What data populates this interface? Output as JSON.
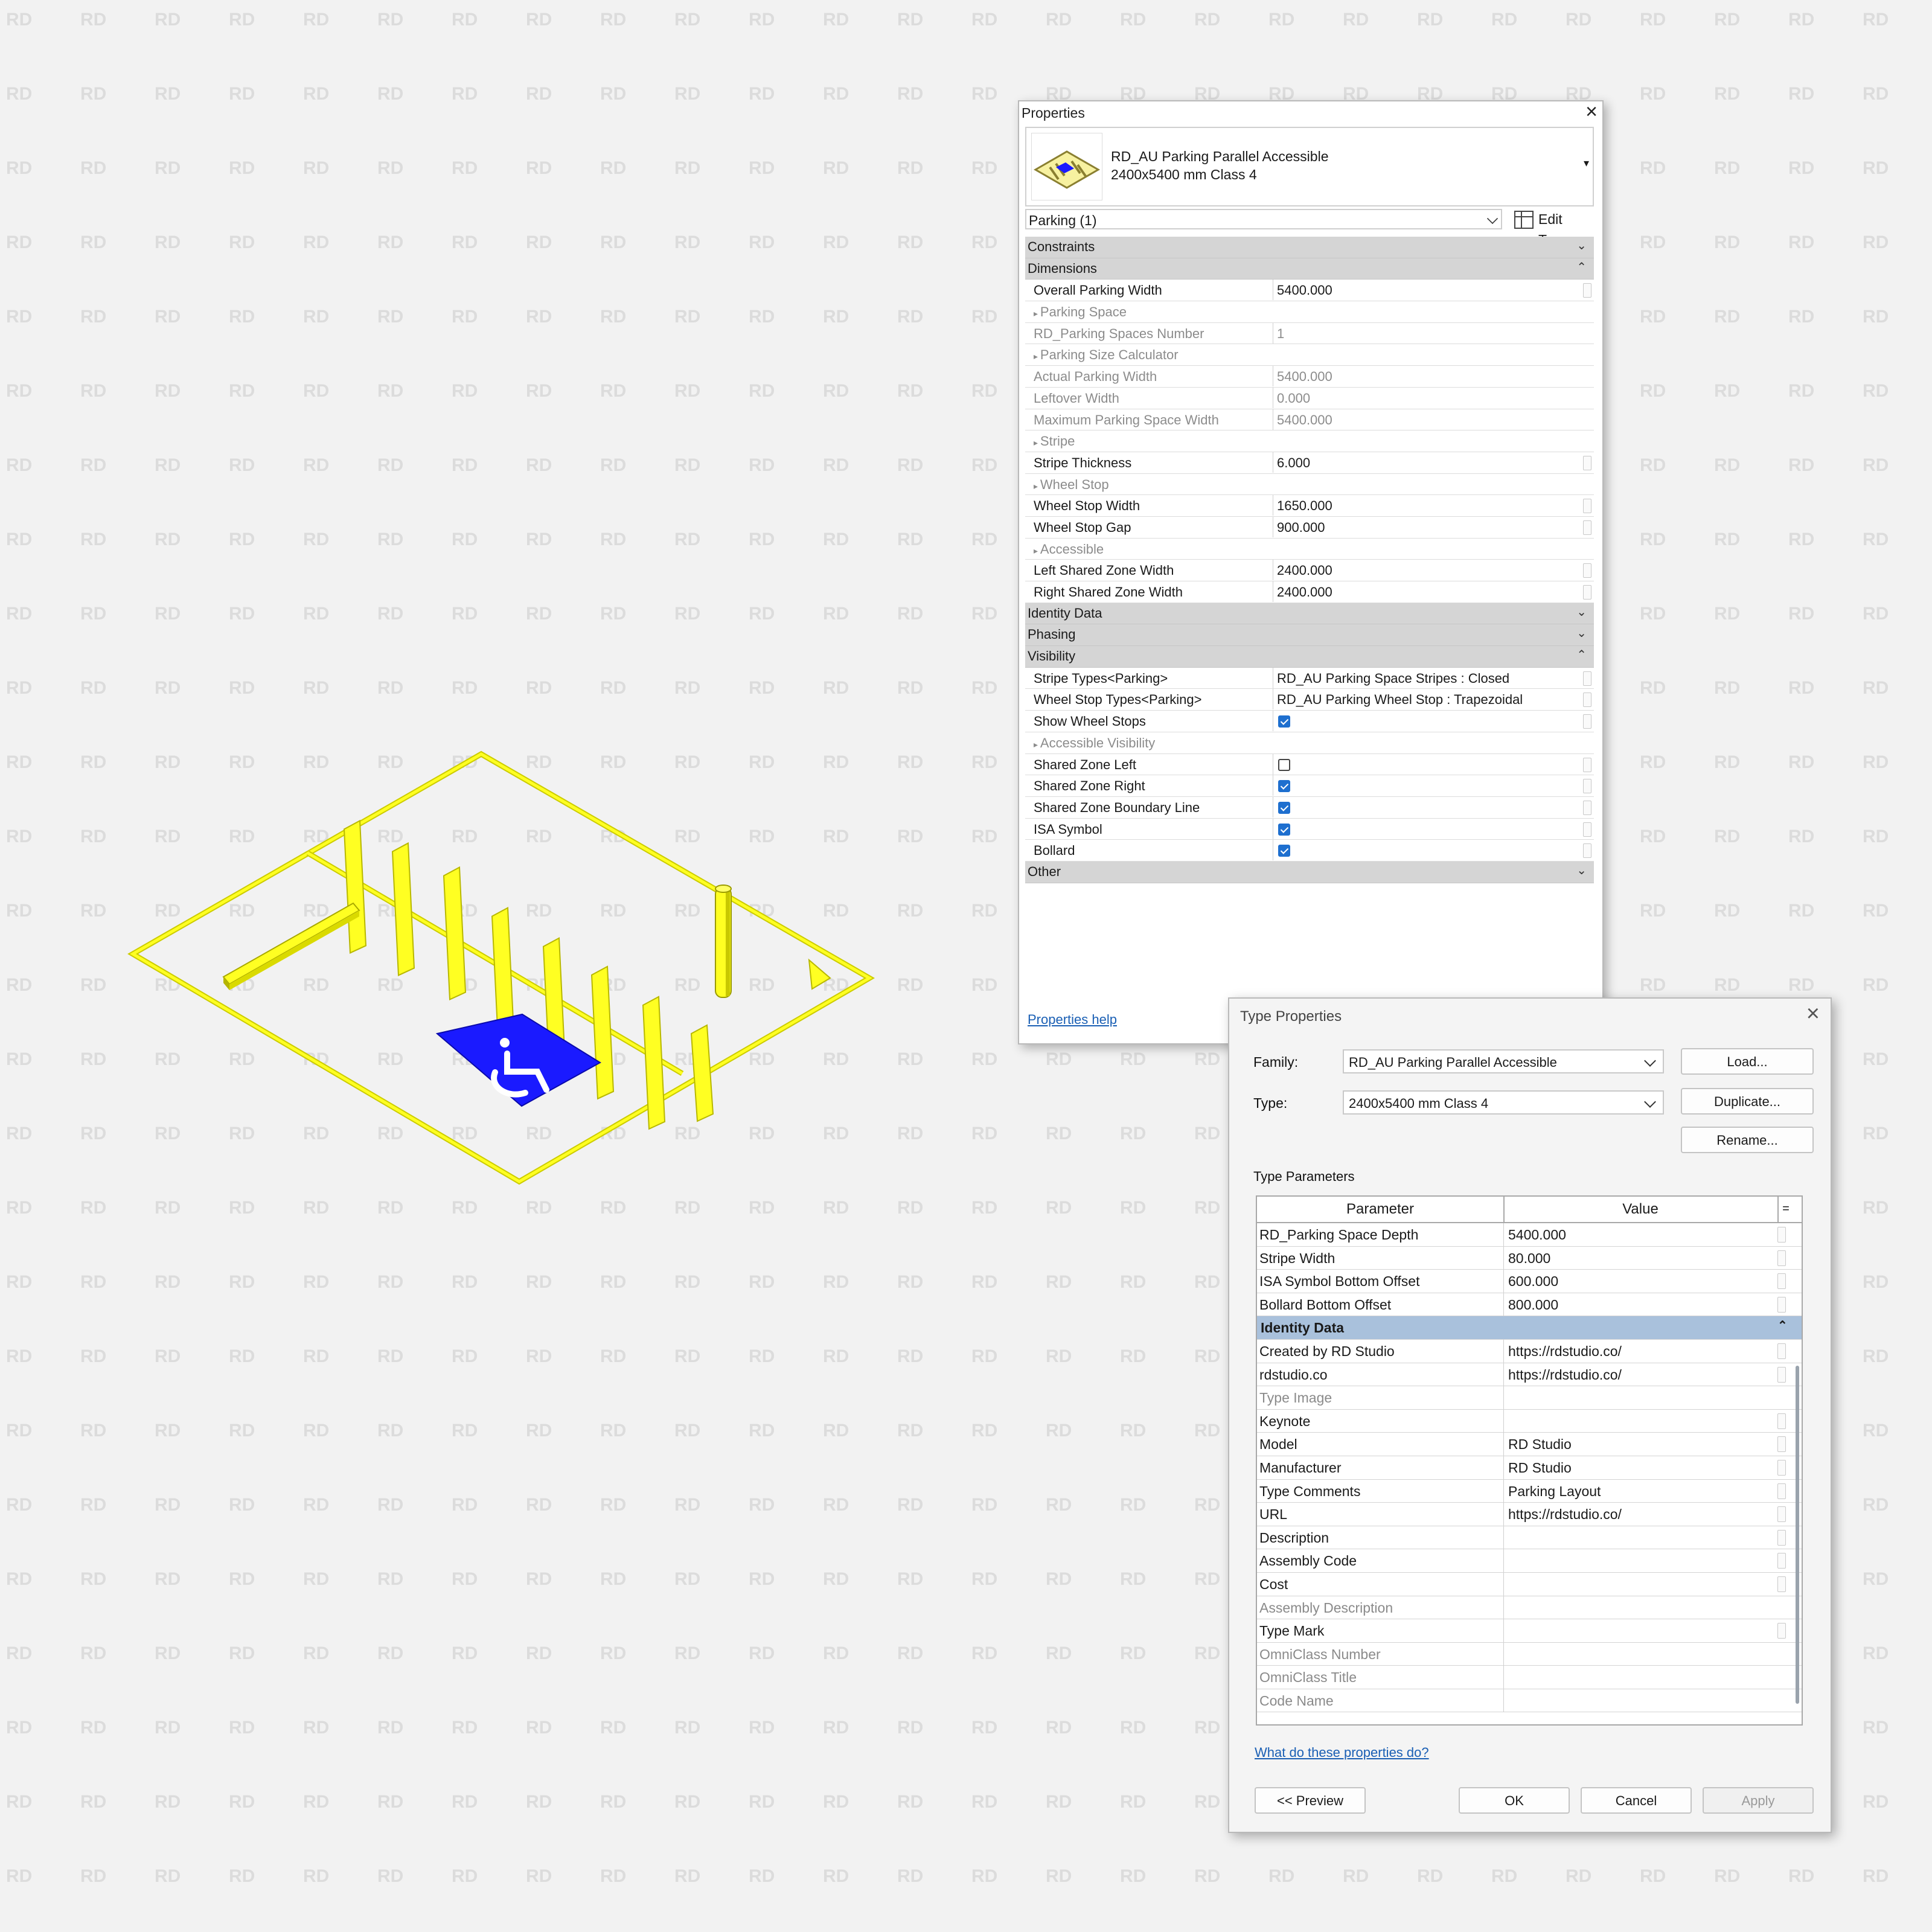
{
  "watermark_text": "RD",
  "properties": {
    "title": "Properties",
    "close_glyph": "×",
    "type_selector": {
      "line1": "RD_AU Parking Parallel Accessible",
      "line2": "2400x5400 mm Class 4"
    },
    "instance_filter": "Parking (1)",
    "edit_type_label": "Edit Type",
    "groups": [
      {
        "name": "Constraints",
        "collapsed": true,
        "rows": []
      },
      {
        "name": "Dimensions",
        "collapsed": false,
        "rows": [
          {
            "name": "Overall Parking Width",
            "value": "5400.000",
            "kind": "text"
          },
          {
            "name": "Parking Space",
            "value": "",
            "kind": "sub"
          },
          {
            "name": "RD_Parking Spaces Number",
            "value": "1",
            "kind": "readonly"
          },
          {
            "name": "Parking Size Calculator",
            "value": "",
            "kind": "sub"
          },
          {
            "name": "Actual Parking Width",
            "value": "5400.000",
            "kind": "readonly"
          },
          {
            "name": "Leftover Width",
            "value": "0.000",
            "kind": "readonly"
          },
          {
            "name": "Maximum Parking Space Width",
            "value": "5400.000",
            "kind": "readonly"
          },
          {
            "name": "Stripe",
            "value": "",
            "kind": "sub"
          },
          {
            "name": "Stripe Thickness",
            "value": "6.000",
            "kind": "text"
          },
          {
            "name": "Wheel Stop",
            "value": "",
            "kind": "sub"
          },
          {
            "name": "Wheel Stop Width",
            "value": "1650.000",
            "kind": "text"
          },
          {
            "name": "Wheel Stop Gap",
            "value": "900.000",
            "kind": "text"
          },
          {
            "name": "Accessible",
            "value": "",
            "kind": "sub"
          },
          {
            "name": "Left Shared Zone Width",
            "value": "2400.000",
            "kind": "text"
          },
          {
            "name": "Right Shared Zone Width",
            "value": "2400.000",
            "kind": "text"
          }
        ]
      },
      {
        "name": "Identity Data",
        "collapsed": true,
        "rows": []
      },
      {
        "name": "Phasing",
        "collapsed": true,
        "rows": []
      },
      {
        "name": "Visibility",
        "collapsed": false,
        "rows": [
          {
            "name": "Stripe Types<Parking>",
            "value": "RD_AU Parking Space Stripes : Closed",
            "kind": "text"
          },
          {
            "name": "Wheel Stop Types<Parking>",
            "value": "RD_AU Parking Wheel Stop : Trapezoidal",
            "kind": "text"
          },
          {
            "name": "Show Wheel Stops",
            "value": true,
            "kind": "check"
          },
          {
            "name": "Accessible Visibility",
            "value": "",
            "kind": "sub"
          },
          {
            "name": "Shared Zone Left",
            "value": false,
            "kind": "check"
          },
          {
            "name": "Shared Zone Right",
            "value": true,
            "kind": "check"
          },
          {
            "name": "Shared Zone Boundary Line",
            "value": true,
            "kind": "check"
          },
          {
            "name": "ISA Symbol",
            "value": true,
            "kind": "check"
          },
          {
            "name": "Bollard",
            "value": true,
            "kind": "check"
          }
        ]
      },
      {
        "name": "Other",
        "collapsed": true,
        "rows": []
      }
    ],
    "help_link": "Properties help"
  },
  "type_properties": {
    "title": "Type Properties",
    "family_label": "Family:",
    "family_value": "RD_AU Parking Parallel Accessible",
    "type_label": "Type:",
    "type_value": "2400x5400 mm Class 4",
    "load_button": "Load...",
    "duplicate_button": "Duplicate...",
    "rename_button": "Rename...",
    "section_label": "Type Parameters",
    "col_parameter": "Parameter",
    "col_value": "Value",
    "col_equals": "=",
    "rows": [
      {
        "name": "RD_Parking Space Depth",
        "value": "5400.000",
        "kind": "text"
      },
      {
        "name": "Stripe Width",
        "value": "80.000",
        "kind": "text"
      },
      {
        "name": "ISA Symbol Bottom Offset",
        "value": "600.000",
        "kind": "text"
      },
      {
        "name": "Bollard Bottom Offset",
        "value": "800.000",
        "kind": "text"
      },
      {
        "name": "Identity Data",
        "value": "",
        "kind": "header"
      },
      {
        "name": "Created by RD Studio",
        "value": "https://rdstudio.co/",
        "kind": "text"
      },
      {
        "name": "rdstudio.co",
        "value": "https://rdstudio.co/",
        "kind": "text"
      },
      {
        "name": "Type Image",
        "value": "",
        "kind": "readonly"
      },
      {
        "name": "Keynote",
        "value": "",
        "kind": "text"
      },
      {
        "name": "Model",
        "value": "RD Studio",
        "kind": "text"
      },
      {
        "name": "Manufacturer",
        "value": "RD Studio",
        "kind": "text"
      },
      {
        "name": "Type Comments",
        "value": "Parking Layout",
        "kind": "text"
      },
      {
        "name": "URL",
        "value": "https://rdstudio.co/",
        "kind": "text"
      },
      {
        "name": "Description",
        "value": "",
        "kind": "text"
      },
      {
        "name": "Assembly Code",
        "value": "",
        "kind": "text"
      },
      {
        "name": "Cost",
        "value": "",
        "kind": "text"
      },
      {
        "name": "Assembly Description",
        "value": "",
        "kind": "readonly"
      },
      {
        "name": "Type Mark",
        "value": "",
        "kind": "text"
      },
      {
        "name": "OmniClass Number",
        "value": "",
        "kind": "readonly"
      },
      {
        "name": "OmniClass Title",
        "value": "",
        "kind": "readonly"
      },
      {
        "name": "Code Name",
        "value": "",
        "kind": "readonly"
      }
    ],
    "help_link": "What do these properties do?",
    "preview_button": "<< Preview",
    "ok_button": "OK",
    "cancel_button": "Cancel",
    "apply_button": "Apply"
  },
  "colors": {
    "marking_yellow": "#ffff22",
    "isa_blue": "#1a1aff",
    "group_gray": "#d5d5d5",
    "identity_header_blue": "#a9c1dc",
    "link_blue": "#1a5fb4"
  }
}
